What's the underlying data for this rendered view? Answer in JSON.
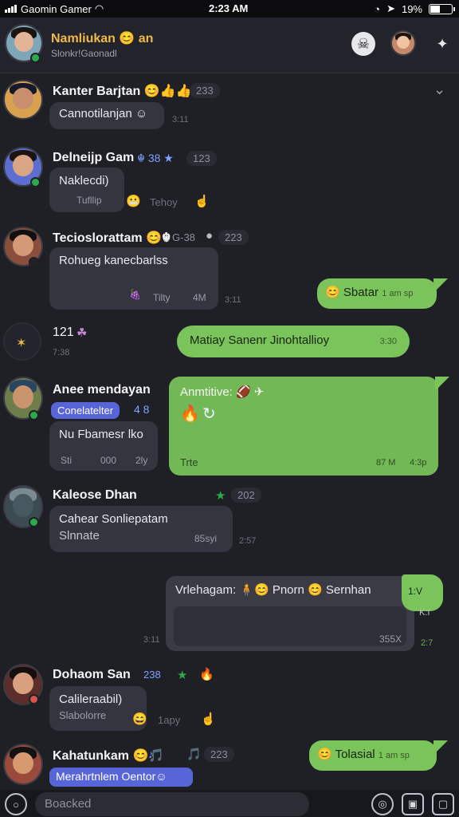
{
  "status": {
    "carrier": "Gaomin Gamer",
    "time": "2:23 AM",
    "battery": "19%"
  },
  "header": {
    "title": "Namliukan 😊 an",
    "subtitle": "Slonkr!Gaonadl"
  },
  "messages": [
    {
      "name": "Kanter Barjtan 😊👍👍",
      "tag": "233",
      "bubble": "Cannotilanjan ☺",
      "time": "3:11"
    },
    {
      "name": "Delneijp Gam",
      "tag": "123",
      "chips": "☬ 38 ★",
      "bubble": "Naklecdi)",
      "bubble_meta_a": "Tufllip",
      "bubble_meta_b": "Tehoy"
    },
    {
      "name": "Tecioslorattam 😊☬",
      "tag": "223",
      "extra": "G-38",
      "bubble": "Rohueg kanecbarlss",
      "bubble_meta_a": "Tilty",
      "bubble_meta_b": "4M",
      "time": "3:11",
      "reply": "Sbatar",
      "reply_meta": "1 am sp"
    },
    {
      "counter": "121",
      "counter_sub": "7:38",
      "reply": "Matiay  Sanenr Jinohtallioy",
      "reply_meta": "3:30"
    },
    {
      "name": "Anee mendayan",
      "pill": "Conelatelter",
      "chips": "4 8",
      "bubble": "Nu Fbamesr lko",
      "bubble_meta_a": "Sti",
      "bubble_meta_b": "000",
      "bubble_meta_c": "2ly",
      "reply": "Anmtitive: 🏈 ✈",
      "reply_meta": "Trte",
      "reply_meta_b": "87 M",
      "reply_meta_c": "4:3p"
    },
    {
      "name": "Kaleose Dhan",
      "tag": "202",
      "bubble": "Cahear Sonliepatam",
      "bubble_line2": "Slnnate",
      "bubble_meta_a": "85syi",
      "time": "2:57"
    },
    {
      "reply": "Vrlehagam: 🧍😊 Pnorn 😊 Sernhan",
      "reply_meta": "355X",
      "side_time": "1:V",
      "side_time2": "K:I",
      "time": "3:11",
      "time2": "2:7"
    },
    {
      "name": "Dohaom San",
      "tag": "238",
      "bubble": "Calileraabil)",
      "bubble_line2": "Slabolorre",
      "bubble_meta_a": "1apy"
    },
    {
      "name": "Kahatunkam 😊🎵",
      "tag": "223",
      "pill": "Merahrtnlem Oentor☺",
      "reply": "Tolasial",
      "reply_meta": "1 am sp"
    }
  ],
  "composer": {
    "placeholder": "Boacked"
  },
  "colors": {
    "background": "#1f2026",
    "bubble": "#34353f",
    "own_bubble": "#7bc45b",
    "accent_blue": "#5865d8",
    "online": "#2ca94b"
  }
}
